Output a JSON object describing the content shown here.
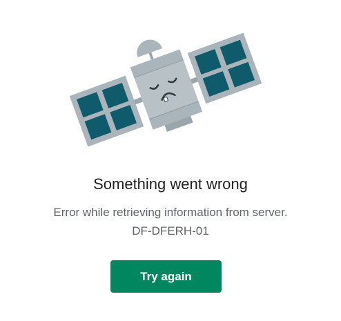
{
  "error": {
    "illustration_icon": "sad-satellite-icon",
    "title": "Something went wrong",
    "message": "Error while retrieving information from server.",
    "code": "DF-DFERH-01",
    "retry_label": "Try again"
  },
  "colors": {
    "accent": "#01875f",
    "panel": "#0f5a6b",
    "frame": "#a9b5bb",
    "body": "#b7c1c6",
    "dark_gray": "#9aa6ac",
    "title_text": "#202124",
    "body_text": "#5f6368"
  }
}
